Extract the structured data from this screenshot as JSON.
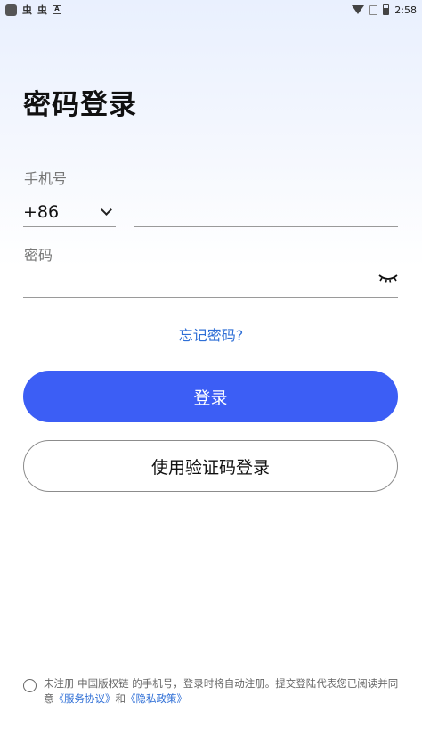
{
  "status_bar": {
    "left_glyphs": [
      "虫",
      "虫"
    ],
    "a_badge": "A",
    "time": "2:58"
  },
  "page": {
    "title": "密码登录"
  },
  "phone": {
    "label": "手机号",
    "country_code": "+86",
    "value": "",
    "placeholder": ""
  },
  "password": {
    "label": "密码",
    "value": "",
    "placeholder": ""
  },
  "links": {
    "forgot": "忘记密码?"
  },
  "buttons": {
    "login": "登录",
    "sms_login": "使用验证码登录"
  },
  "agreement": {
    "text_before": "未注册 中国版权链 的手机号，登录时将自动注册。提交登陆代表您已阅读并同意",
    "service_link": "《服务协议》",
    "and": "和",
    "privacy_link": "《隐私政策》"
  },
  "colors": {
    "primary": "#3c5ef5",
    "link": "#2f6fd6"
  }
}
